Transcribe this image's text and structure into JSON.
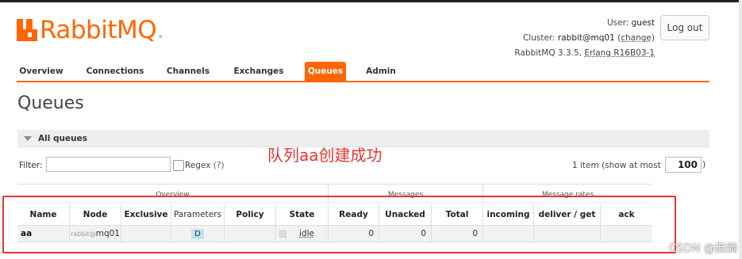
{
  "logo": {
    "text": "RabbitMQ",
    "dot": "."
  },
  "user": {
    "label": "User:",
    "name": "guest"
  },
  "cluster": {
    "label": "Cluster:",
    "name": "rabbit@mq01",
    "change": "change"
  },
  "version": {
    "text": "RabbitMQ 3.3.5,",
    "erlang": "Erlang R16B03-1"
  },
  "logout_label": "Log out",
  "nav": {
    "tabs": [
      "Overview",
      "Connections",
      "Channels",
      "Exchanges",
      "Queues",
      "Admin"
    ],
    "active": "Queues"
  },
  "page_title": "Queues",
  "section_title": "All queues",
  "annotation": "队列aa创建成功",
  "filter": {
    "label": "Filter:",
    "value": "",
    "regex_label": "Regex",
    "regex_hint": "(?)"
  },
  "pagination": {
    "items_text": "1 item (show at most",
    "page_size": "100",
    "close_paren": ")"
  },
  "table": {
    "groups": [
      "Overview",
      "Messages",
      "Message rates"
    ],
    "columns": [
      "Name",
      "Node",
      "Exclusive",
      "Parameters",
      "Policy",
      "State",
      "Ready",
      "Unacked",
      "Total",
      "incoming",
      "deliver / get",
      "ack"
    ],
    "rows": [
      {
        "name": "aa",
        "node_host": "rabbit@",
        "node_short": "mq01",
        "exclusive": "",
        "parameters": "D",
        "policy": "",
        "state": "idle",
        "ready": "0",
        "unacked": "0",
        "total": "0",
        "incoming": "",
        "deliver_get": "",
        "ack": ""
      }
    ]
  },
  "watermark": "CSDN @無熵",
  "colors": {
    "brand": "#ff6600",
    "annotation": "#e8342f",
    "param_badge": "#bde4ec"
  }
}
